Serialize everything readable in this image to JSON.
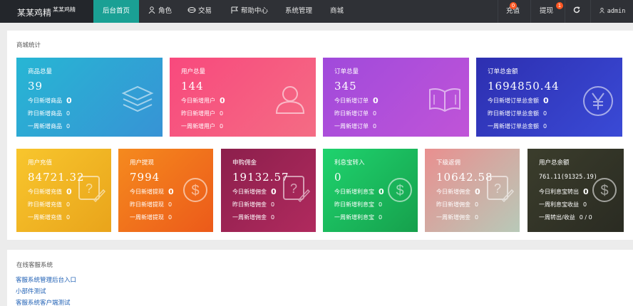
{
  "header": {
    "brand": "某某鸡精",
    "brand_sub": "某某鸡精",
    "nav": [
      "后台首页",
      "角色",
      "交易",
      "帮助中心",
      "系统管理",
      "商城"
    ],
    "recharge": {
      "label": "充值",
      "badge": "0"
    },
    "withdraw": {
      "label": "提现",
      "badge": "1"
    },
    "user": "admin"
  },
  "stats": {
    "title": "商城统计",
    "row1": [
      {
        "title": "商品总量",
        "value": "39",
        "l1": "今日新增商品",
        "v1": "0",
        "l2": "昨日新增商品",
        "v2": "0",
        "l3": "一周新增商品",
        "v3": "0",
        "icon": "stack-icon"
      },
      {
        "title": "用户总量",
        "value": "144",
        "l1": "今日新增用户",
        "v1": "0",
        "l2": "昨日新增用户",
        "v2": "0",
        "l3": "一周新增用户",
        "v3": "0",
        "icon": "user-icon"
      },
      {
        "title": "订单总量",
        "value": "345",
        "l1": "今日新增订单",
        "v1": "0",
        "l2": "昨日新增订单",
        "v2": "0",
        "l3": "一周新增订单",
        "v3": "0",
        "icon": "book-icon"
      },
      {
        "title": "订单总金额",
        "value": "1694850.44",
        "l1": "今日新增订单总金额",
        "v1": "0",
        "l2": "昨日新增订单总金额",
        "v2": "0",
        "l3": "一周新增订单总金额",
        "v3": "0",
        "icon": "yen-icon"
      }
    ],
    "row2": [
      {
        "title": "用户充值",
        "value": "84721.32",
        "l1": "今日新增充值",
        "v1": "0",
        "l2": "昨日新增充值",
        "v2": "0",
        "l3": "一周新增充值",
        "v3": "0",
        "icon": "edit-icon"
      },
      {
        "title": "用户提现",
        "value": "7994",
        "l1": "今日新增提现",
        "v1": "0",
        "l2": "昨日新增提现",
        "v2": "0",
        "l3": "一周新增提现",
        "v3": "0",
        "icon": "dollar-icon"
      },
      {
        "title": "申购佣金",
        "value": "19132.57",
        "l1": "今日新增佣金",
        "v1": "0",
        "l2": "昨日新增佣金",
        "v2": "0",
        "l3": "一周新增佣金",
        "v3": "0",
        "icon": "edit-icon"
      },
      {
        "title": "利息宝转入",
        "value": "0",
        "l1": "今日新增利息宝",
        "v1": "0",
        "l2": "昨日新增利息宝",
        "v2": "0",
        "l3": "一周新增利息宝",
        "v3": "0",
        "icon": "dollar-icon"
      },
      {
        "title": "下级返佣",
        "value": "10642.58",
        "l1": "今日新增佣金",
        "v1": "0",
        "l2": "昨日新增佣金",
        "v2": "0",
        "l3": "一周新增佣金",
        "v3": "0",
        "icon": "edit-icon"
      },
      {
        "title": "用户总余额",
        "value": "761.11(91325.19)",
        "l1": "今日利息宝转出",
        "v1": "0",
        "l2": "一周利息宝收益",
        "v2": "0",
        "l3": "一周转出/收益",
        "v3": "0 / 0",
        "icon": "dollar-icon"
      }
    ]
  },
  "support": {
    "title": "在线客服系统",
    "links": [
      "客服系统管理后台入口",
      "小部件测试",
      "客服系统客户端测试"
    ]
  }
}
